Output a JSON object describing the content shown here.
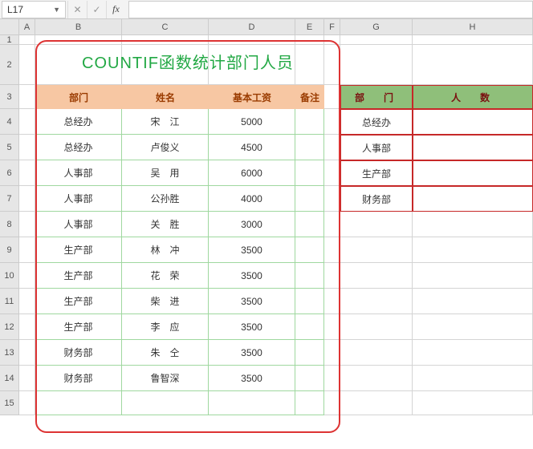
{
  "formula_bar": {
    "name_box": "L17",
    "cancel": "✕",
    "confirm": "✓",
    "fx_label": "fx",
    "formula_value": ""
  },
  "columns": [
    "A",
    "B",
    "C",
    "D",
    "E",
    "F",
    "G",
    "H"
  ],
  "rows": [
    "1",
    "2",
    "3",
    "4",
    "5",
    "6",
    "7",
    "8",
    "9",
    "10",
    "11",
    "12",
    "13",
    "14",
    "15"
  ],
  "title": "COUNTIF函数统计部门人员",
  "table_headers": {
    "dept": "部门",
    "name": "姓名",
    "salary": "基本工资",
    "note": "备注"
  },
  "table_rows": [
    {
      "dept": "总经办",
      "name": "宋　江",
      "salary": "5000"
    },
    {
      "dept": "总经办",
      "name": "卢俊义",
      "salary": "4500"
    },
    {
      "dept": "人事部",
      "name": "吴　用",
      "salary": "6000"
    },
    {
      "dept": "人事部",
      "name": "公孙胜",
      "salary": "4000"
    },
    {
      "dept": "人事部",
      "name": "关　胜",
      "salary": "3000"
    },
    {
      "dept": "生产部",
      "name": "林　冲",
      "salary": "3500"
    },
    {
      "dept": "生产部",
      "name": "花　荣",
      "salary": "3500"
    },
    {
      "dept": "生产部",
      "name": "柴　进",
      "salary": "3500"
    },
    {
      "dept": "生产部",
      "name": "李　应",
      "salary": "3500"
    },
    {
      "dept": "财务部",
      "name": "朱　仝",
      "salary": "3500"
    },
    {
      "dept": "财务部",
      "name": "鲁智深",
      "salary": "3500"
    }
  ],
  "summary_headers": {
    "dept": "部　门",
    "count": "人　数"
  },
  "summary_rows": [
    {
      "dept": "总经办",
      "count": ""
    },
    {
      "dept": "人事部",
      "count": ""
    },
    {
      "dept": "生产部",
      "count": ""
    },
    {
      "dept": "财务部",
      "count": ""
    }
  ],
  "chart_data": {
    "type": "table",
    "title": "COUNTIF函数统计部门人员",
    "columns": [
      "部门",
      "姓名",
      "基本工资",
      "备注"
    ],
    "rows": [
      [
        "总经办",
        "宋江",
        5000,
        ""
      ],
      [
        "总经办",
        "卢俊义",
        4500,
        ""
      ],
      [
        "人事部",
        "吴用",
        6000,
        ""
      ],
      [
        "人事部",
        "公孙胜",
        4000,
        ""
      ],
      [
        "人事部",
        "关胜",
        3000,
        ""
      ],
      [
        "生产部",
        "林冲",
        3500,
        ""
      ],
      [
        "生产部",
        "花荣",
        3500,
        ""
      ],
      [
        "生产部",
        "柴进",
        3500,
        ""
      ],
      [
        "生产部",
        "李应",
        3500,
        ""
      ],
      [
        "财务部",
        "朱仝",
        3500,
        ""
      ],
      [
        "财务部",
        "鲁智深",
        3500,
        ""
      ]
    ],
    "summary": {
      "columns": [
        "部门",
        "人数"
      ],
      "rows": [
        [
          "总经办",
          null
        ],
        [
          "人事部",
          null
        ],
        [
          "生产部",
          null
        ],
        [
          "财务部",
          null
        ]
      ]
    }
  }
}
